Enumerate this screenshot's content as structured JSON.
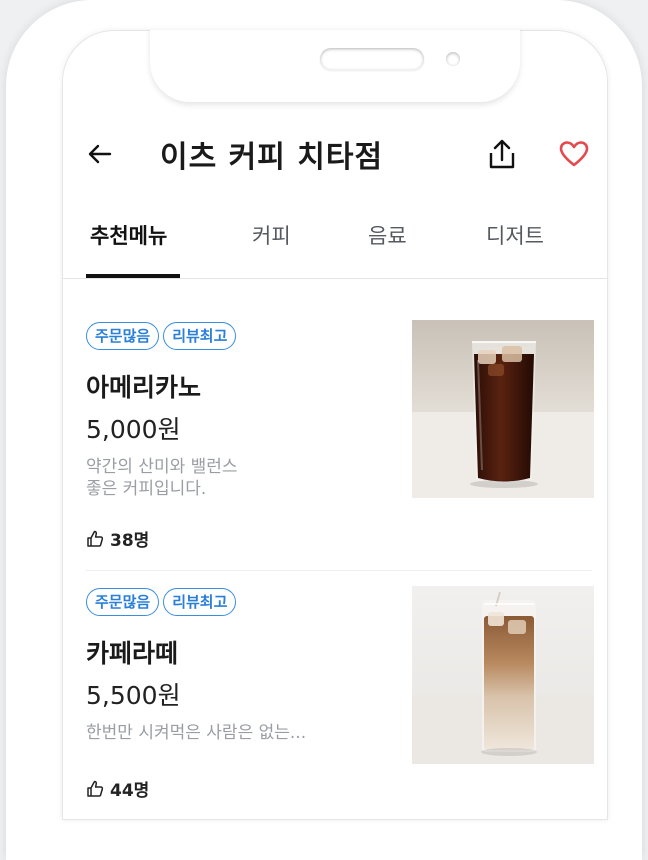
{
  "header": {
    "title": "이츠 커피 치타점"
  },
  "tabs": [
    {
      "label": "추천메뉴",
      "active": true
    },
    {
      "label": "커피",
      "active": false
    },
    {
      "label": "음료",
      "active": false
    },
    {
      "label": "디저트",
      "active": false
    }
  ],
  "menu": [
    {
      "badges": [
        "주문많음",
        "리뷰최고"
      ],
      "name": "아메리카노",
      "price": "5,000원",
      "description_lines": [
        "약간의 산미와 밸런스",
        "좋은 커피입니다."
      ],
      "likes": "38명"
    },
    {
      "badges": [
        "주문많음",
        "리뷰최고"
      ],
      "name": "카페라떼",
      "price": "5,500원",
      "description_lines": [
        "한번만 시켜먹은 사람은 없는..."
      ],
      "likes": "44명"
    }
  ],
  "icons": {
    "back": "back-arrow-icon",
    "share": "share-icon",
    "favorite": "heart-icon",
    "like": "thumbs-up-icon"
  },
  "colors": {
    "accent": "#2a7fd6",
    "heart": "#e5484d"
  }
}
